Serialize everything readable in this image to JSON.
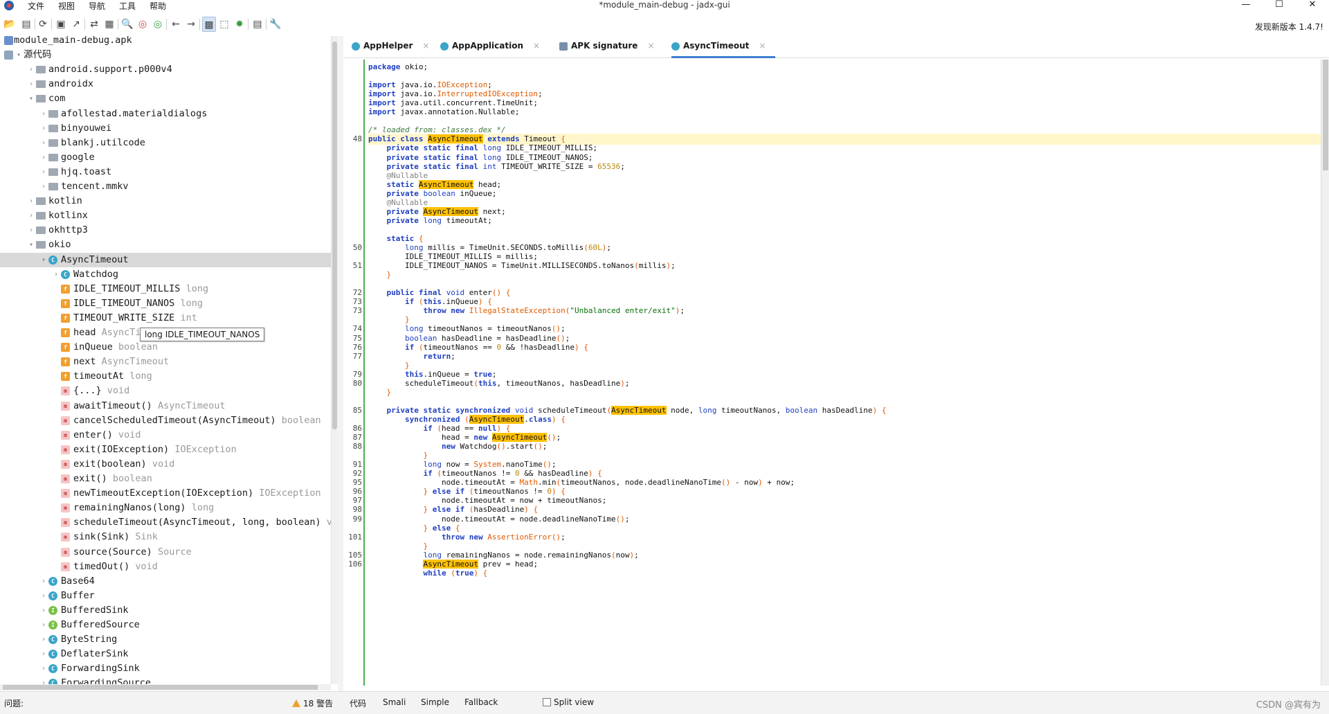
{
  "window": {
    "title": "*module_main-debug - jadx-gui",
    "controls": [
      "—",
      "☐",
      "✕"
    ]
  },
  "menu": [
    "文件",
    "视图",
    "导航",
    "工具",
    "帮助"
  ],
  "toolbar": {
    "buttons": [
      "open-icon",
      "add-files-icon",
      "reload-icon",
      "save-icon",
      "export-icon",
      "sync-icon",
      "flatten-icon",
      "search-icon",
      "search-class-icon",
      "search-usage-icon",
      "back-icon",
      "forward-icon",
      "deobfuscation-icon",
      "quark-icon",
      "debug-icon",
      "log-icon",
      "settings-icon"
    ],
    "update_notice": "发现新版本 1.4.7!"
  },
  "tree": [
    {
      "depth": 0,
      "icon": "apk",
      "chev": "",
      "label": "module_main-debug.apk",
      "type": ""
    },
    {
      "depth": 0,
      "icon": "src",
      "chev": "▾",
      "label": "源代码",
      "type": ""
    },
    {
      "depth": 1,
      "icon": "pkg",
      "chev": "›",
      "label": "android.support.p000v4",
      "type": ""
    },
    {
      "depth": 1,
      "icon": "pkg",
      "chev": "›",
      "label": "androidx",
      "type": ""
    },
    {
      "depth": 1,
      "icon": "pkg",
      "chev": "▾",
      "label": "com",
      "type": ""
    },
    {
      "depth": 2,
      "icon": "pkg",
      "chev": "›",
      "label": "afollestad.materialdialogs",
      "type": ""
    },
    {
      "depth": 2,
      "icon": "pkg",
      "chev": "›",
      "label": "binyouwei",
      "type": ""
    },
    {
      "depth": 2,
      "icon": "pkg",
      "chev": "›",
      "label": "blankj.utilcode",
      "type": ""
    },
    {
      "depth": 2,
      "icon": "pkg",
      "chev": "›",
      "label": "google",
      "type": ""
    },
    {
      "depth": 2,
      "icon": "pkg",
      "chev": "›",
      "label": "hjq.toast",
      "type": ""
    },
    {
      "depth": 2,
      "icon": "pkg",
      "chev": "›",
      "label": "tencent.mmkv",
      "type": ""
    },
    {
      "depth": 1,
      "icon": "pkg",
      "chev": "›",
      "label": "kotlin",
      "type": ""
    },
    {
      "depth": 1,
      "icon": "pkg",
      "chev": "›",
      "label": "kotlinx",
      "type": ""
    },
    {
      "depth": 1,
      "icon": "pkg",
      "chev": "›",
      "label": "okhttp3",
      "type": ""
    },
    {
      "depth": 1,
      "icon": "pkg",
      "chev": "▾",
      "label": "okio",
      "type": ""
    },
    {
      "depth": 2,
      "icon": "cls",
      "chev": "▾",
      "label": "AsyncTimeout",
      "type": "",
      "sel": true
    },
    {
      "depth": 3,
      "icon": "cls",
      "chev": "›",
      "label": "Watchdog",
      "type": ""
    },
    {
      "depth": 3,
      "icon": "sfld",
      "chev": "",
      "label": "IDLE_TIMEOUT_MILLIS",
      "type": "long"
    },
    {
      "depth": 3,
      "icon": "sfld",
      "chev": "",
      "label": "IDLE_TIMEOUT_NANOS",
      "type": "long"
    },
    {
      "depth": 3,
      "icon": "sfld",
      "chev": "",
      "label": "TIMEOUT_WRITE_SIZE",
      "type": "int"
    },
    {
      "depth": 3,
      "icon": "fld",
      "chev": "",
      "label": "head",
      "type": "AsyncTimeout"
    },
    {
      "depth": 3,
      "icon": "fld",
      "chev": "",
      "label": "inQueue",
      "type": "boolean"
    },
    {
      "depth": 3,
      "icon": "fld",
      "chev": "",
      "label": "next",
      "type": "AsyncTimeout"
    },
    {
      "depth": 3,
      "icon": "fld",
      "chev": "",
      "label": "timeoutAt",
      "type": "long"
    },
    {
      "depth": 3,
      "icon": "mth",
      "chev": "",
      "label": "{...}",
      "type": "void"
    },
    {
      "depth": 3,
      "icon": "mth",
      "chev": "",
      "label": "awaitTimeout()",
      "type": "AsyncTimeout"
    },
    {
      "depth": 3,
      "icon": "mth",
      "chev": "",
      "label": "cancelScheduledTimeout(AsyncTimeout)",
      "type": "boolean"
    },
    {
      "depth": 3,
      "icon": "mth",
      "chev": "",
      "label": "enter()",
      "type": "void"
    },
    {
      "depth": 3,
      "icon": "mth",
      "chev": "",
      "label": "exit(IOException)",
      "type": "IOException"
    },
    {
      "depth": 3,
      "icon": "mth",
      "chev": "",
      "label": "exit(boolean)",
      "type": "void"
    },
    {
      "depth": 3,
      "icon": "mth",
      "chev": "",
      "label": "exit()",
      "type": "boolean"
    },
    {
      "depth": 3,
      "icon": "mth",
      "chev": "",
      "label": "newTimeoutException(IOException)",
      "type": "IOException"
    },
    {
      "depth": 3,
      "icon": "mth",
      "chev": "",
      "label": "remainingNanos(long)",
      "type": "long"
    },
    {
      "depth": 3,
      "icon": "mth",
      "chev": "",
      "label": "scheduleTimeout(AsyncTimeout, long, boolean)",
      "type": "voi"
    },
    {
      "depth": 3,
      "icon": "mth",
      "chev": "",
      "label": "sink(Sink)",
      "type": "Sink"
    },
    {
      "depth": 3,
      "icon": "mth",
      "chev": "",
      "label": "source(Source)",
      "type": "Source"
    },
    {
      "depth": 3,
      "icon": "mth",
      "chev": "",
      "label": "timedOut()",
      "type": "void"
    },
    {
      "depth": 2,
      "icon": "cls",
      "chev": "›",
      "label": "Base64",
      "type": ""
    },
    {
      "depth": 2,
      "icon": "cls",
      "chev": "›",
      "label": "Buffer",
      "type": ""
    },
    {
      "depth": 2,
      "icon": "int",
      "chev": "›",
      "label": "BufferedSink",
      "type": ""
    },
    {
      "depth": 2,
      "icon": "int",
      "chev": "›",
      "label": "BufferedSource",
      "type": ""
    },
    {
      "depth": 2,
      "icon": "cls",
      "chev": "›",
      "label": "ByteString",
      "type": ""
    },
    {
      "depth": 2,
      "icon": "cls",
      "chev": "›",
      "label": "DeflaterSink",
      "type": ""
    },
    {
      "depth": 2,
      "icon": "cls",
      "chev": "›",
      "label": "ForwardingSink",
      "type": ""
    },
    {
      "depth": 2,
      "icon": "cls",
      "chev": "›",
      "label": "ForwardingSource",
      "type": ""
    }
  ],
  "tooltip": "long IDLE_TIMEOUT_NANOS",
  "tabs": [
    {
      "label": "AppHelper",
      "icon": "class"
    },
    {
      "label": "AppApplication",
      "icon": "class"
    },
    {
      "label": "APK signature",
      "icon": "signature"
    },
    {
      "label": "AsyncTimeout",
      "icon": "class",
      "active": true
    }
  ],
  "code_lines": [
    {
      "ln": "",
      "html": "<span class='kw'>package</span> okio;"
    },
    {
      "ln": "",
      "html": ""
    },
    {
      "ln": "",
      "html": "<span class='kw'>import</span> java.io.<span class='ex'>IOException</span>;"
    },
    {
      "ln": "",
      "html": "<span class='kw'>import</span> java.io.<span class='ex'>InterruptedIOException</span>;"
    },
    {
      "ln": "",
      "html": "<span class='kw'>import</span> java.util.concurrent.TimeUnit;"
    },
    {
      "ln": "",
      "html": "<span class='kw'>import</span> javax.annotation.Nullable;"
    },
    {
      "ln": "",
      "html": ""
    },
    {
      "ln": "",
      "html": "<span class='cm'>/* loaded from: classes.dex */</span>"
    },
    {
      "ln": "48",
      "hl": true,
      "html": "<span class='kw'>public class</span> <span class='mk'>AsyncTimeout</span> <span class='kw'>extends</span> Timeout <span class='paren'>{</span>"
    },
    {
      "ln": "",
      "html": "    <span class='kw'>private static final</span> <span class='ty'>long</span> IDLE_TIMEOUT_MILLIS;"
    },
    {
      "ln": "",
      "html": "    <span class='kw'>private static final</span> <span class='ty'>long</span> IDLE_TIMEOUT_NANOS;"
    },
    {
      "ln": "",
      "html": "    <span class='kw'>private static final</span> <span class='ty'>int</span> TIMEOUT_WRITE_SIZE = <span class='num'>65536</span>;"
    },
    {
      "ln": "",
      "html": "    <span class='an'>@Nullable</span>"
    },
    {
      "ln": "",
      "html": "    <span class='kw'>static</span> <span class='mk'>AsyncTimeout</span> head;"
    },
    {
      "ln": "",
      "html": "    <span class='kw'>private</span> <span class='ty'>boolean</span> inQueue;"
    },
    {
      "ln": "",
      "html": "    <span class='an'>@Nullable</span>"
    },
    {
      "ln": "",
      "html": "    <span class='kw'>private</span> <span class='mk'>AsyncTimeout</span> next;"
    },
    {
      "ln": "",
      "html": "    <span class='kw'>private</span> <span class='ty'>long</span> timeoutAt;"
    },
    {
      "ln": "",
      "html": ""
    },
    {
      "ln": "",
      "html": "    <span class='kw'>static</span> <span class='paren'>{</span>"
    },
    {
      "ln": "50",
      "html": "        <span class='ty'>long</span> millis = TimeUnit.SECONDS.toMillis<span class='paren'>(</span><span class='num'>60L</span><span class='paren'>)</span>;"
    },
    {
      "ln": "",
      "html": "        IDLE_TIMEOUT_MILLIS = millis;"
    },
    {
      "ln": "51",
      "html": "        IDLE_TIMEOUT_NANOS = TimeUnit.MILLISECONDS.toNanos<span class='paren'>(</span>millis<span class='paren'>)</span>;"
    },
    {
      "ln": "",
      "html": "    <span class='paren'>}</span>"
    },
    {
      "ln": "",
      "html": ""
    },
    {
      "ln": "72",
      "html": "    <span class='kw'>public final</span> <span class='ty'>void</span> enter<span class='paren'>() {</span>"
    },
    {
      "ln": "73",
      "html": "        <span class='kw'>if</span> <span class='paren'>(</span><span class='kw'>this</span>.inQueue<span class='paren'>) {</span>"
    },
    {
      "ln": "73",
      "html": "            <span class='kw'>throw new</span> <span class='ex'>IllegalStateException</span><span class='paren'>(</span><span class='str'>\"Unbalanced enter/exit\"</span><span class='paren'>)</span>;"
    },
    {
      "ln": "",
      "html": "        <span class='paren'>}</span>"
    },
    {
      "ln": "74",
      "html": "        <span class='ty'>long</span> timeoutNanos = timeoutNanos<span class='paren'>()</span>;"
    },
    {
      "ln": "75",
      "html": "        <span class='ty'>boolean</span> hasDeadline = hasDeadline<span class='paren'>()</span>;"
    },
    {
      "ln": "76",
      "html": "        <span class='kw'>if</span> <span class='paren'>(</span>timeoutNanos == <span class='num'>0</span> &amp;&amp; !hasDeadline<span class='paren'>) {</span>"
    },
    {
      "ln": "77",
      "html": "            <span class='kw'>return</span>;"
    },
    {
      "ln": "",
      "html": "        <span class='paren'>}</span>"
    },
    {
      "ln": "79",
      "html": "        <span class='kw'>this</span>.inQueue = <span class='kw'>true</span>;"
    },
    {
      "ln": "80",
      "html": "        scheduleTimeout<span class='paren'>(</span><span class='kw'>this</span>, timeoutNanos, hasDeadline<span class='paren'>)</span>;"
    },
    {
      "ln": "",
      "html": "    <span class='paren'>}</span>"
    },
    {
      "ln": "",
      "html": ""
    },
    {
      "ln": "85",
      "html": "    <span class='kw'>private static synchronized</span> <span class='ty'>void</span> scheduleTimeout<span class='paren'>(</span><span class='mk'>AsyncTimeout</span> node, <span class='ty'>long</span> timeoutNanos, <span class='ty'>boolean</span> hasDeadline<span class='paren'>) {</span>"
    },
    {
      "ln": "",
      "html": "        <span class='kw'>synchronized</span> <span class='paren'>(</span><span class='mk'>AsyncTimeout</span>.<span class='kw'>class</span><span class='paren'>) {</span>"
    },
    {
      "ln": "86",
      "html": "            <span class='kw'>if</span> <span class='paren'>(</span>head == <span class='kw'>null</span><span class='paren'>) {</span>"
    },
    {
      "ln": "87",
      "html": "                head = <span class='kw'>new</span> <span class='mk'>AsyncTimeout</span><span class='paren'>()</span>;"
    },
    {
      "ln": "88",
      "html": "                <span class='kw'>new</span> Watchdog<span class='paren'>()</span>.start<span class='paren'>()</span>;"
    },
    {
      "ln": "",
      "html": "            <span class='paren'>}</span>"
    },
    {
      "ln": "91",
      "html": "            <span class='ty'>long</span> now = <span class='ex'>System</span>.nanoTime<span class='paren'>()</span>;"
    },
    {
      "ln": "92",
      "html": "            <span class='kw'>if</span> <span class='paren'>(</span>timeoutNanos != <span class='num'>0</span> &amp;&amp; hasDeadline<span class='paren'>) {</span>"
    },
    {
      "ln": "95",
      "html": "                node.timeoutAt = <span class='ex'>Math</span>.min<span class='paren'>(</span>timeoutNanos, node.deadlineNanoTime<span class='paren'>()</span> - now<span class='paren'>)</span> + now;"
    },
    {
      "ln": "96",
      "html": "            <span class='paren'>}</span> <span class='kw'>else if</span> <span class='paren'>(</span>timeoutNanos != <span class='num'>0</span><span class='paren'>) {</span>"
    },
    {
      "ln": "97",
      "html": "                node.timeoutAt = now + timeoutNanos;"
    },
    {
      "ln": "98",
      "html": "            <span class='paren'>}</span> <span class='kw'>else if</span> <span class='paren'>(</span>hasDeadline<span class='paren'>) {</span>"
    },
    {
      "ln": "99",
      "html": "                node.timeoutAt = node.deadlineNanoTime<span class='paren'>()</span>;"
    },
    {
      "ln": "",
      "html": "            <span class='paren'>}</span> <span class='kw'>else</span> <span class='paren'>{</span>"
    },
    {
      "ln": "101",
      "html": "                <span class='kw'>throw new</span> <span class='ex'>AssertionError</span><span class='paren'>()</span>;"
    },
    {
      "ln": "",
      "html": "            <span class='paren'>}</span>"
    },
    {
      "ln": "105",
      "html": "            <span class='ty'>long</span> remainingNanos = node.remainingNanos<span class='paren'>(</span>now<span class='paren'>)</span>;"
    },
    {
      "ln": "106",
      "html": "            <span class='mk'>AsyncTimeout</span> prev = head;"
    },
    {
      "ln": "",
      "html": "            <span class='kw'>while</span> <span class='paren'>(</span><span class='kw'>true</span><span class='paren'>) {</span>"
    }
  ],
  "status": {
    "issues_label": "问题:",
    "warnings": "18 警告",
    "modes": [
      "代码",
      "Smali",
      "Simple",
      "Fallback"
    ],
    "split_view": "Split view"
  },
  "watermark": "CSDN @宾有为"
}
